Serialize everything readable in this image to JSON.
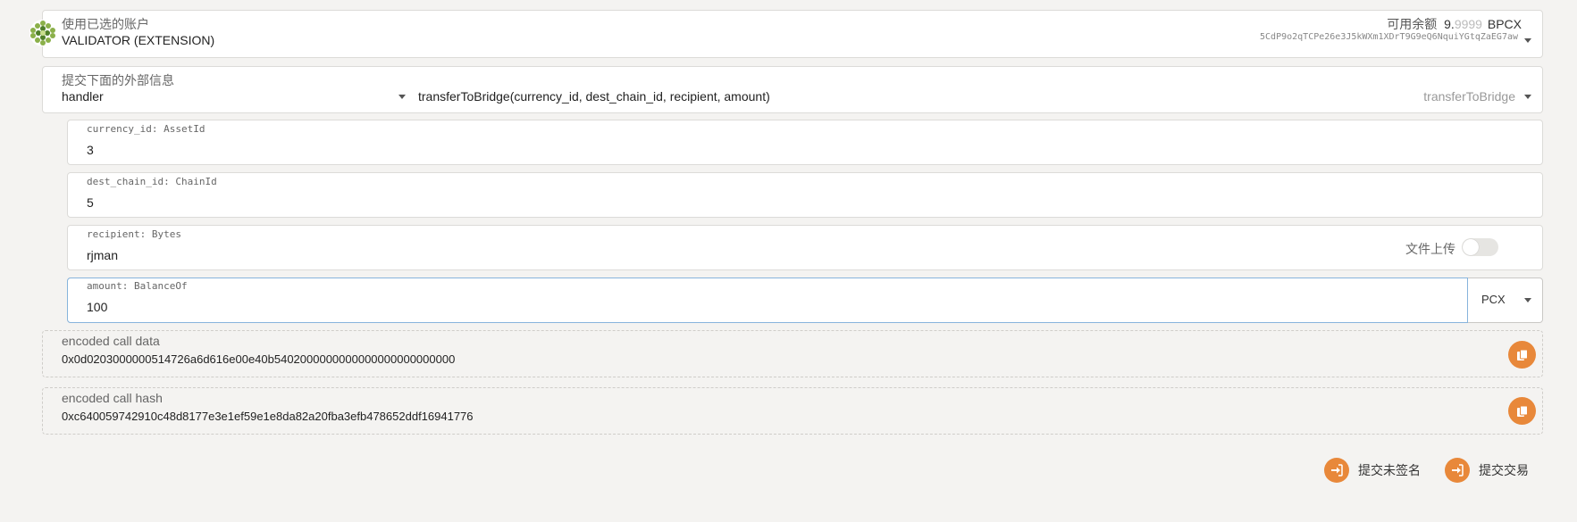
{
  "account": {
    "label": "使用已选的账户",
    "name": "VALIDATOR (EXTENSION)",
    "balance_label": "可用余额",
    "balance_int": "9.",
    "balance_frac": "9999",
    "balance_unit": "BPCX",
    "address": "5CdP9o2qTCPe26e3J5kWXm1XDrT9G9eQ6NquiYGtqZaEG7aw"
  },
  "extrinsic": {
    "label": "提交下面的外部信息",
    "section": "handler",
    "call_signature": "transferToBridge(currency_id, dest_chain_id, recipient, amount)",
    "call_name": "transferToBridge"
  },
  "params": {
    "currency_id": {
      "label": "currency_id: AssetId",
      "value": "3"
    },
    "dest_chain_id": {
      "label": "dest_chain_id: ChainId",
      "value": "5"
    },
    "recipient": {
      "label": "recipient: Bytes",
      "value": "rjman",
      "upload_label": "文件上传"
    },
    "amount": {
      "label": "amount: BalanceOf",
      "value": "100",
      "unit": "PCX"
    }
  },
  "encoded": {
    "data_label": "encoded call data",
    "data_value": "0x0d0203000000514726a6d616e00e40b5402000000000000000000000000",
    "hash_label": "encoded call hash",
    "hash_value": "0xc640059742910c48d8177e3e1ef59e1e8da82a20fba3efb478652ddf16941776"
  },
  "actions": {
    "submit_unsigned": "提交未签名",
    "submit": "提交交易"
  },
  "colors": {
    "accent": "#e8883a"
  }
}
